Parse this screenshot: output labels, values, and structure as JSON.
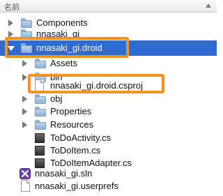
{
  "header": {
    "column_name": "名前"
  },
  "tree": {
    "items": [
      {
        "label": "Components",
        "icon": "folder-icon",
        "disclosure": "closed"
      },
      {
        "label": "nnasaki_gi",
        "icon": "folder-icon",
        "disclosure": "closed"
      },
      {
        "label": "nnasaki_gi.droid",
        "icon": "folder-icon",
        "disclosure": "open",
        "selected": true
      },
      {
        "label": "Assets",
        "icon": "folder-icon",
        "disclosure": "closed"
      },
      {
        "label": "bin",
        "icon": "folder-icon",
        "disclosure": "closed"
      },
      {
        "label": "nnasaki_gi.droid.csproj",
        "icon": "file-icon"
      },
      {
        "label": "obj",
        "icon": "folder-icon",
        "disclosure": "closed"
      },
      {
        "label": "Properties",
        "icon": "folder-icon",
        "disclosure": "closed"
      },
      {
        "label": "Resources",
        "icon": "folder-icon",
        "disclosure": "closed"
      },
      {
        "label": "ToDoActivity.cs",
        "icon": "cs-file-icon"
      },
      {
        "label": "ToDoItem.cs",
        "icon": "cs-file-icon"
      },
      {
        "label": "ToDoItemAdapter.cs",
        "icon": "cs-file-icon"
      },
      {
        "label": "nnasaki_gi.sln",
        "icon": "solution-icon"
      },
      {
        "label": "nnasaki_gi.userprefs",
        "icon": "file-icon"
      }
    ]
  },
  "colors": {
    "selection": "#2f6ad0",
    "highlight_outline": "#f5931e",
    "folder": "#8fb2d6"
  }
}
